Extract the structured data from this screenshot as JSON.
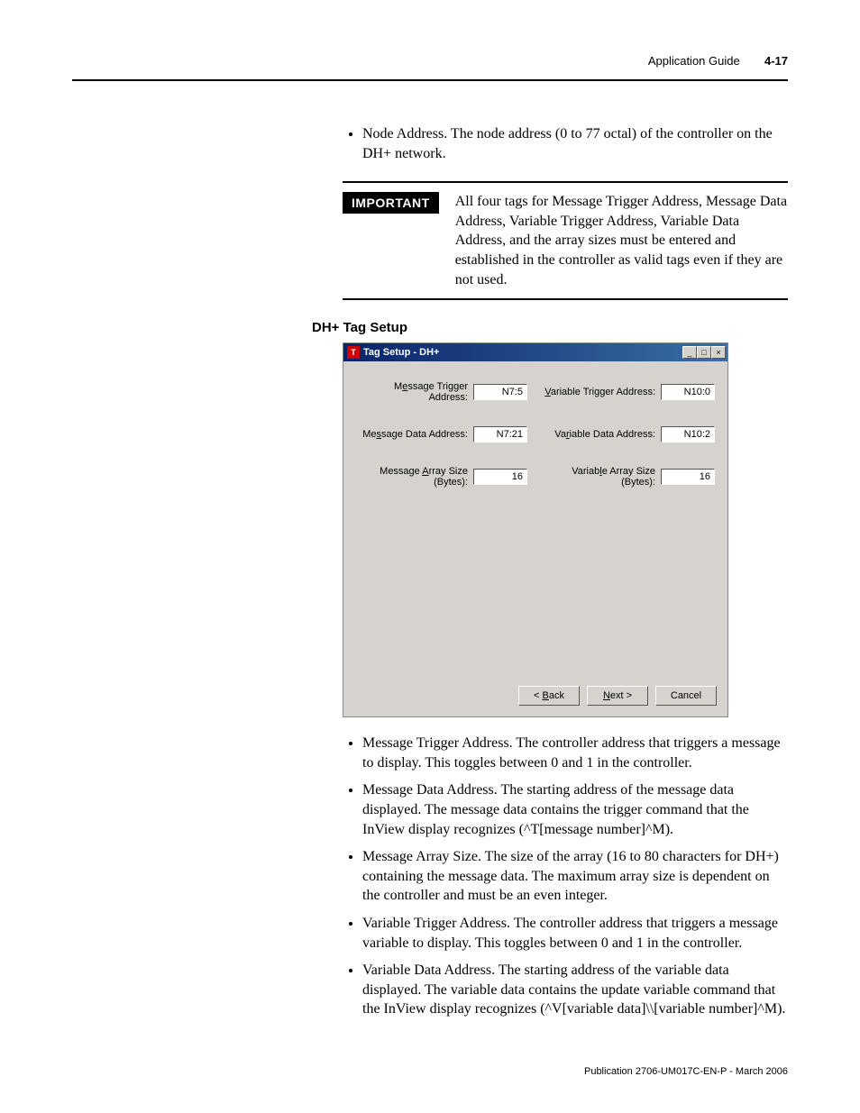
{
  "header": {
    "label": "Application Guide",
    "page": "4-17"
  },
  "intro_bullet": "Node Address. The node address (0 to 77 octal) of the controller on the DH+ network.",
  "important": {
    "label": "IMPORTANT",
    "text": "All four tags for Message Trigger Address, Message Data Address, Variable Trigger Address, Variable Data Address, and the array sizes must be entered and established in the controller as valid tags even if they are not used."
  },
  "section_heading": "DH+ Tag Setup",
  "dialog": {
    "title": "Tag Setup - DH+",
    "fields": {
      "msg_trigger": {
        "label_pre": "M",
        "label_u": "e",
        "label_post": "ssage Trigger Address:",
        "value": "N7:5"
      },
      "var_trigger": {
        "label_pre": "",
        "label_u": "V",
        "label_post": "ariable Trigger Address:",
        "value": "N10:0"
      },
      "msg_data": {
        "label_pre": "Me",
        "label_u": "s",
        "label_post": "sage Data Address:",
        "value": "N7:21"
      },
      "var_data": {
        "label_pre": "Va",
        "label_u": "r",
        "label_post": "iable Data Address:",
        "value": "N10:2"
      },
      "msg_array": {
        "label_pre": "Message ",
        "label_u": "A",
        "label_post": "rray Size (Bytes):",
        "value": "16"
      },
      "var_array": {
        "label_pre": "Variab",
        "label_u": "l",
        "label_post": "e Array Size (Bytes):",
        "value": "16"
      }
    },
    "buttons": {
      "back": {
        "pre": "< ",
        "u": "B",
        "post": "ack"
      },
      "next": {
        "pre": "",
        "u": "N",
        "post": "ext >"
      },
      "cancel": {
        "text": "Cancel"
      }
    }
  },
  "body_bullets": [
    "Message Trigger Address. The controller address that triggers a message to display. This toggles between 0 and 1 in the controller.",
    "Message Data Address. The starting address of the message data displayed. The message data contains the trigger command that the InView display recognizes (^T[message number]^M).",
    "Message Array Size. The size of the array (16 to 80 characters for DH+) containing the message data. The maximum array size is dependent on the controller and must be an even integer.",
    "Variable Trigger Address. The controller address that triggers a message variable to display. This toggles between 0 and 1 in the controller.",
    "Variable Data Address. The starting address of the variable data displayed. The variable data contains the update variable command that the InView display recognizes (^V[variable data]\\\\[variable number]^M)."
  ],
  "footer": "Publication 2706-UM017C-EN-P - March 2006"
}
